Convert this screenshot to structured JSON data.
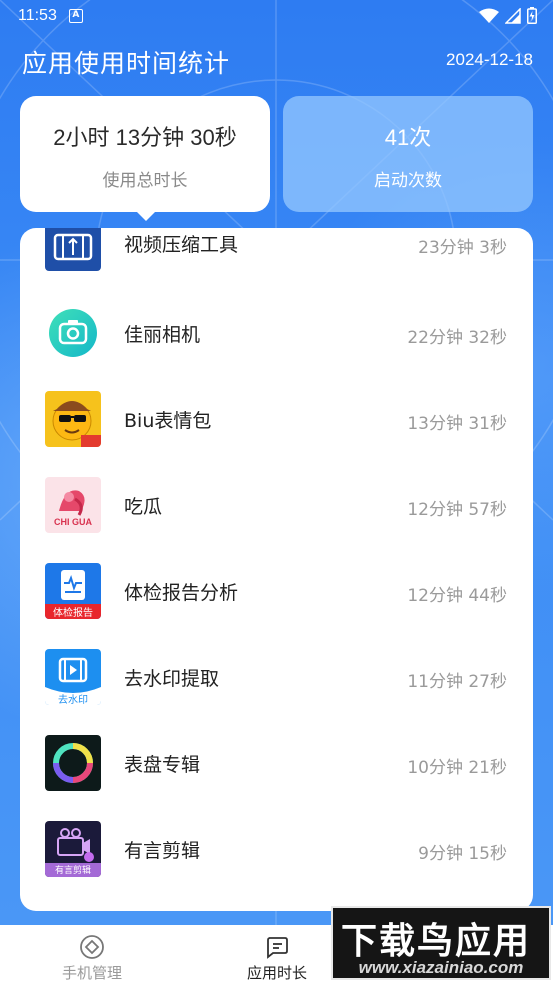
{
  "status_bar": {
    "time": "11:53",
    "notification_icon": "A"
  },
  "header": {
    "title": "应用使用时间统计",
    "date": "2024-12-18"
  },
  "summary": {
    "total_time": {
      "value": "2小时 13分钟 30秒",
      "label": "使用总时长"
    },
    "launch_count": {
      "value": "41次",
      "label": "启动次数"
    }
  },
  "apps": [
    {
      "name": "视频压缩工具",
      "time": "23分钟 3秒",
      "icon": "video-compress-icon"
    },
    {
      "name": "佳丽相机",
      "time": "22分钟 32秒",
      "icon": "camera-icon"
    },
    {
      "name": "Biu表情包",
      "time": "13分钟 31秒",
      "icon": "emoji-face-icon"
    },
    {
      "name": "吃瓜",
      "time": "12分钟 57秒",
      "icon": "chigua-icon",
      "icon_text": "CHI GUA"
    },
    {
      "name": "体检报告分析",
      "time": "12分钟 44秒",
      "icon": "health-report-icon",
      "icon_text": "体检报告"
    },
    {
      "name": "去水印提取",
      "time": "11分钟 27秒",
      "icon": "watermark-remove-icon",
      "icon_text": "去水印"
    },
    {
      "name": "表盘专辑",
      "time": "10分钟 21秒",
      "icon": "dial-ring-icon"
    },
    {
      "name": "有言剪辑",
      "time": "9分钟 15秒",
      "icon": "video-edit-icon",
      "icon_text": "有言剪辑"
    }
  ],
  "bottom_nav": [
    {
      "label": "手机管理",
      "icon": "phone-manage-icon",
      "active": false
    },
    {
      "label": "应用时长",
      "icon": "app-duration-icon",
      "active": true
    }
  ],
  "watermark": {
    "title": "下载鸟应用",
    "url": "www.xiazainiao.com"
  },
  "colors": {
    "primary": "#3b86f0",
    "card_inactive": "#96c8ff",
    "text_dark": "#222222",
    "text_gray": "#9a9a9a"
  }
}
